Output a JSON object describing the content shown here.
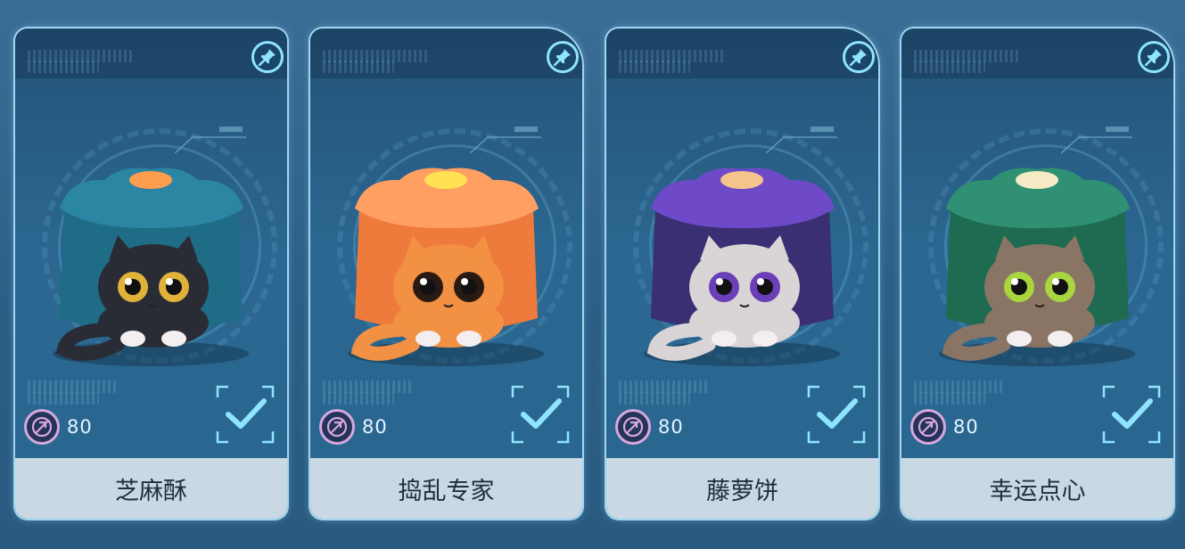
{
  "cards": [
    {
      "name": "芝麻酥",
      "price": "80",
      "box_color": "#1f6c86",
      "box_top": "#2a86a3",
      "cat_color": "#2a2c35",
      "eye_color": "#e0b23a",
      "lid_center": "#ff9d4f"
    },
    {
      "name": "捣乱专家",
      "price": "80",
      "box_color": "#ee7a3c",
      "box_top": "#ff9f62",
      "cat_color": "#f29043",
      "eye_color": "#2a1a14",
      "lid_center": "#ffe153"
    },
    {
      "name": "藤萝饼",
      "price": "80",
      "box_color": "#3a2f72",
      "box_top": "#6e4ac9",
      "cat_color": "#d9d4d6",
      "eye_color": "#6b3fb8",
      "lid_center": "#f5c58c"
    },
    {
      "name": "幸运点心",
      "price": "80",
      "box_color": "#1f6b52",
      "box_top": "#2f9074",
      "cat_color": "#8a7565",
      "eye_color": "#a8d540",
      "lid_center": "#f7ebc6"
    }
  ],
  "icons": {
    "pin": "pin-icon",
    "currency": "currency-icon",
    "check": "check-icon"
  },
  "colors": {
    "accent": "#8fe4ff",
    "frame": "#9fd6f0",
    "name_bar": "#cad8e3"
  }
}
